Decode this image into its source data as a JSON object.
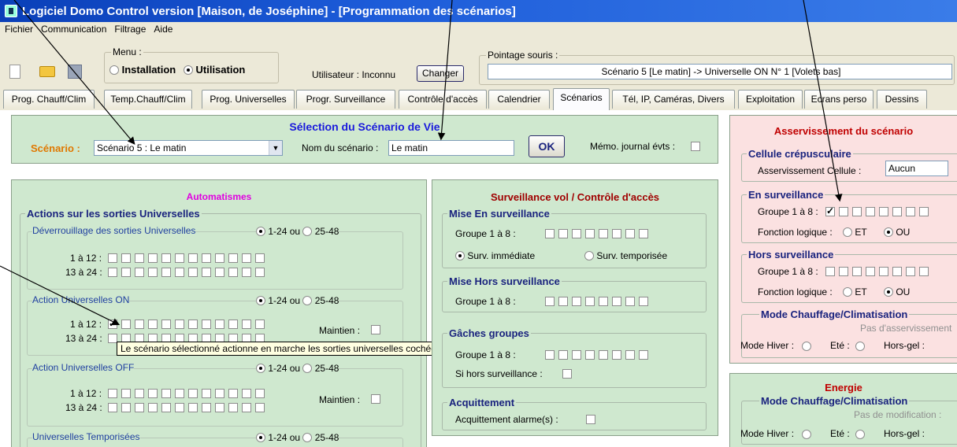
{
  "window": {
    "title": "Logiciel Domo Control version  [Maison, de Joséphine] - [Programmation des scénarios]"
  },
  "menubar": [
    "Fichier",
    "Communication",
    "Filtrage",
    "Aide"
  ],
  "toolbar": {
    "menu_label": "Menu :",
    "mode_installation": "Installation",
    "mode_utilisation": "Utilisation",
    "user_text": "Utilisateur : Inconnu",
    "change_button": "Changer",
    "pointer_label": "Pointage souris :",
    "pointer_value": "Scénario 5 [Le matin] -> Universelle ON N° 1 [Volets bas]"
  },
  "tabs": [
    "Prog. Chauff/Clim",
    "Temp.Chauff/Clim",
    "Prog. Universelles",
    "Progr. Surveillance",
    "Contrôle d'accès",
    "Calendrier",
    "Scénarios",
    "Tél, IP, Caméras, Divers",
    "Exploitation",
    "Ecrans perso",
    "Dessins"
  ],
  "active_tab": 6,
  "selection": {
    "title": "Sélection du Scénario de Vie",
    "scenario_label": "Scénario :",
    "scenario_value": "Scénario 5 : Le matin",
    "name_label": "Nom du scénario :",
    "name_value": "Le matin",
    "ok": "OK",
    "memo_label": "Mémo. journal évts :"
  },
  "automatismes": {
    "title": "Automatismes",
    "group_title": "Actions sur les sorties Universelles",
    "range_a": "1-24 ou",
    "range_b": "25-48",
    "row1": "1 à 12 :",
    "row2": "13 à 24 :",
    "maintien": "Maintien :",
    "sections": [
      "Déverrouillage des sorties Universelles",
      "Action Universelles ON",
      "Action Universelles OFF",
      "Universelles Temporisées"
    ]
  },
  "tooltip": "Le scénario sélectionné actionne en marche les sorties universelles cochées",
  "surveillance": {
    "title": "Surveillance vol / Contrôle d'accès",
    "mise_en": "Mise En surveillance",
    "groupe": "Groupe 1 à 8 :",
    "surv_immediate": "Surv. immédiate",
    "surv_temporisee": "Surv. temporisée",
    "mise_hors": "Mise Hors surveillance",
    "gaches": "Gâches groupes",
    "si_hors": "Si hors surveillance :",
    "acquittement": "Acquittement",
    "acquittement_alarme": "Acquittement alarme(s) :"
  },
  "asservissement": {
    "title": "Asservissement du scénario",
    "cellule": "Cellule crépusculaire",
    "cellule_label": "Asservissement Cellule :",
    "cellule_value": "Aucun",
    "en_surv": "En surveillance",
    "groupe": "Groupe 1 à 8 :",
    "fonction": "Fonction logique :",
    "et": "ET",
    "ou": "OU",
    "hors_surv": "Hors surveillance",
    "mode": "Mode Chauffage/Climatisation",
    "pas_asserv": "Pas d'asservissement",
    "mode_hiver": "Mode Hiver :",
    "ete": "Eté :",
    "hors_gel": "Hors-gel :"
  },
  "energie": {
    "title": "Energie",
    "mode": "Mode Chauffage/Climatisation",
    "pas_modif": "Pas de modification :",
    "mode_hiver": "Mode Hiver :",
    "ete": "Eté :",
    "hors_gel": "Hors-gel :"
  },
  "colors": {
    "title_blue": "#0a3fb8",
    "panel_green": "#cfe8cf",
    "panel_pink": "#fbe1e1",
    "orange": "#e07800",
    "magenta": "#e000e0",
    "dark_red": "#a00000"
  }
}
